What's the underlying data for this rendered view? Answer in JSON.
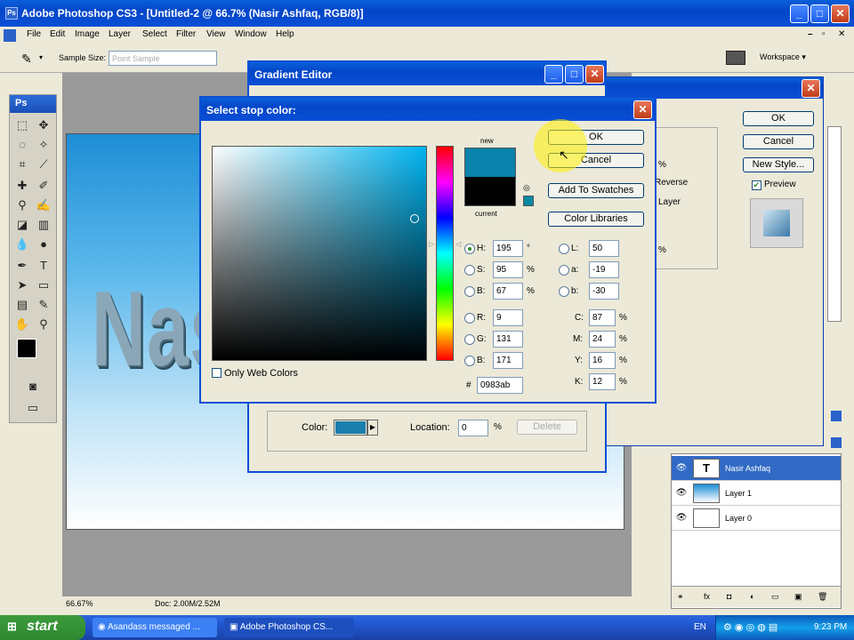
{
  "window": {
    "title": "Adobe Photoshop CS3 - [Untitled-2 @ 66.7% (Nasir Ashfaq, RGB/8)]",
    "app_icon": "Ps"
  },
  "menu": [
    "File",
    "Edit",
    "Image",
    "Layer",
    "Select",
    "Filter",
    "View",
    "Window",
    "Help"
  ],
  "options_bar": {
    "sample_size_label": "Sample Size:",
    "sample_size_value": "Point Sample",
    "workspace_label": "Workspace ▾"
  },
  "tools_panel": {
    "header": "Ps"
  },
  "document": {
    "text": "Nas"
  },
  "status_bar": {
    "zoom": "66.67%",
    "doc": "Doc: 2.00M/2.52M"
  },
  "layer_style_dialog": {
    "ok": "OK",
    "cancel": "Cancel",
    "new_style": "New Style...",
    "preview_label": "Preview",
    "frag1": "%",
    "frag2": "Reverse",
    "frag3": "Layer",
    "frag4": "%"
  },
  "gradient_editor": {
    "title": "Gradient Editor",
    "color_label": "Color:",
    "location_label": "Location:",
    "location_value": "0",
    "percent": "%",
    "delete_label": "Delete",
    "color_value": "#1a7fae"
  },
  "stop_color_dialog": {
    "title": "Select stop color:",
    "ok": "OK",
    "cancel": "Cancel",
    "add_to_swatches": "Add To Swatches",
    "color_libraries": "Color Libraries",
    "new_label": "new",
    "current_label": "current",
    "only_web_colors": "Only Web Colors",
    "new_color": "#0983ab",
    "current_color": "#000000",
    "hsb": [
      {
        "label": "H:",
        "value": "195",
        "unit": "°",
        "selected": true
      },
      {
        "label": "S:",
        "value": "95",
        "unit": "%"
      },
      {
        "label": "B:",
        "value": "67",
        "unit": "%"
      }
    ],
    "rgb": [
      {
        "label": "R:",
        "value": "9"
      },
      {
        "label": "G:",
        "value": "131"
      },
      {
        "label": "B:",
        "value": "171"
      }
    ],
    "lab": [
      {
        "label": "L:",
        "value": "50"
      },
      {
        "label": "a:",
        "value": "-19"
      },
      {
        "label": "b:",
        "value": "-30"
      }
    ],
    "cmyk": [
      {
        "label": "C:",
        "value": "87",
        "unit": "%"
      },
      {
        "label": "M:",
        "value": "24",
        "unit": "%"
      },
      {
        "label": "Y:",
        "value": "16",
        "unit": "%"
      },
      {
        "label": "K:",
        "value": "12",
        "unit": "%"
      }
    ],
    "hex_label": "#",
    "hex_value": "0983ab"
  },
  "layers": [
    {
      "name": "Nasir Ashfaq",
      "thumb": "T",
      "selected": true
    },
    {
      "name": "Layer 1",
      "thumb": ""
    },
    {
      "name": "Layer 0",
      "thumb": ""
    }
  ],
  "taskbar": {
    "start": "start",
    "tasks": [
      "Asandass messaged ...",
      "Adobe Photoshop CS..."
    ],
    "lang": "EN",
    "time": "9:23 PM"
  }
}
